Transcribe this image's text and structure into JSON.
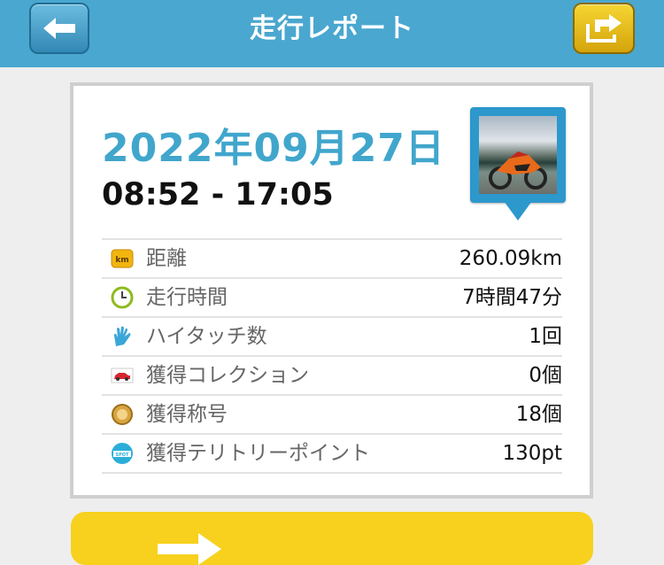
{
  "header": {
    "title": "走行レポート",
    "back_icon": "arrow-left-icon",
    "share_icon": "share-arrow-icon"
  },
  "report": {
    "date": "2022年09月27日",
    "time_range": "08:52 - 17:05",
    "photo": "motorcycle-thumbnail",
    "stats": [
      {
        "icon": "km-icon",
        "label": "距離",
        "value": "260.09km"
      },
      {
        "icon": "clock-icon",
        "label": "走行時間",
        "value": "7時間47分"
      },
      {
        "icon": "high-five-icon",
        "label": "ハイタッチ数",
        "value": "1回"
      },
      {
        "icon": "car-icon",
        "label": "獲得コレクション",
        "value": "0個"
      },
      {
        "icon": "medal-icon",
        "label": "獲得称号",
        "value": "18個"
      },
      {
        "icon": "spot-icon",
        "label": "獲得テリトリーポイント",
        "value": "130pt"
      }
    ]
  },
  "colors": {
    "header": "#4aa7cf",
    "accent": "#41a6cc",
    "share_button": "#f0c419",
    "bottom_button": "#f7d11d"
  }
}
